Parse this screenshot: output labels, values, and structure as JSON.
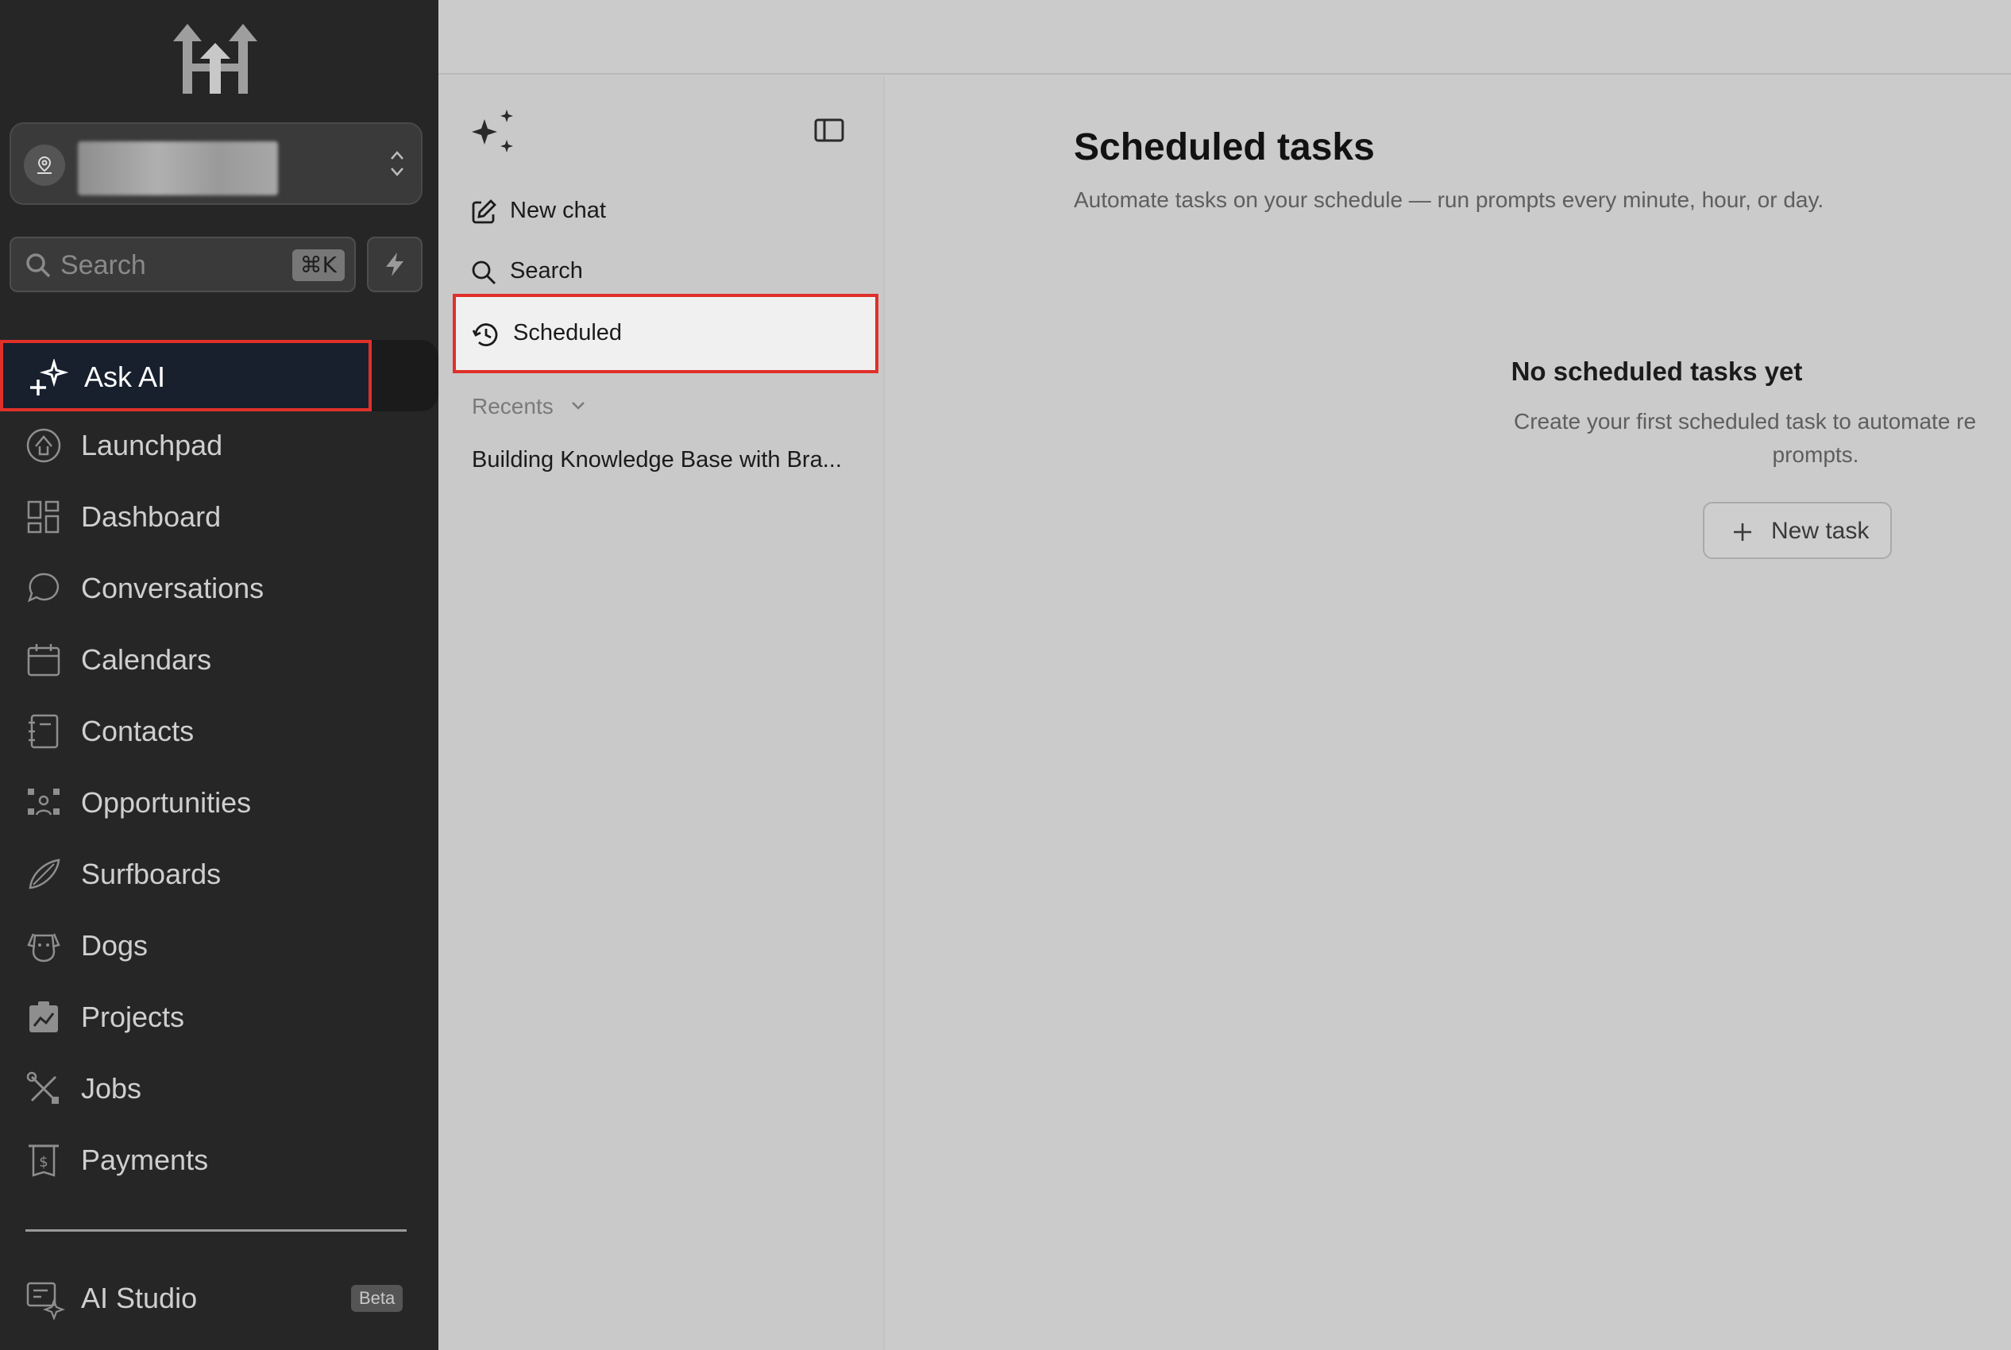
{
  "sidebar": {
    "search": {
      "placeholder": "Search",
      "shortcut": "⌘K"
    },
    "ask_ai_label": "Ask AI",
    "items": [
      {
        "label": "Launchpad",
        "icon": "launchpad-icon"
      },
      {
        "label": "Dashboard",
        "icon": "dashboard-icon"
      },
      {
        "label": "Conversations",
        "icon": "chat-bubble-icon"
      },
      {
        "label": "Calendars",
        "icon": "calendar-icon"
      },
      {
        "label": "Contacts",
        "icon": "contact-book-icon"
      },
      {
        "label": "Opportunities",
        "icon": "opportunities-icon"
      },
      {
        "label": "Surfboards",
        "icon": "surfboard-icon"
      },
      {
        "label": "Dogs",
        "icon": "dog-icon"
      },
      {
        "label": "Projects",
        "icon": "projects-icon"
      },
      {
        "label": "Jobs",
        "icon": "tools-icon"
      },
      {
        "label": "Payments",
        "icon": "payments-icon"
      }
    ],
    "ai_studio": {
      "label": "AI Studio",
      "badge": "Beta"
    }
  },
  "panel": {
    "new_chat": "New chat",
    "search": "Search",
    "scheduled": "Scheduled",
    "recents_label": "Recents",
    "recents": [
      "Building Knowledge Base with Bra..."
    ]
  },
  "main": {
    "title": "Scheduled tasks",
    "subtitle": "Automate tasks on your schedule — run prompts every minute, hour, or day.",
    "empty_title": "No scheduled tasks yet",
    "empty_description_line1": "Create your first scheduled task to automate re",
    "empty_description_line2": "prompts.",
    "new_task_label": "New task"
  },
  "colors": {
    "sidebar_bg": "#262626",
    "highlight_border": "#e0302a",
    "ask_ai_bg": "#18202e",
    "content_bg": "#cbcbcb"
  }
}
